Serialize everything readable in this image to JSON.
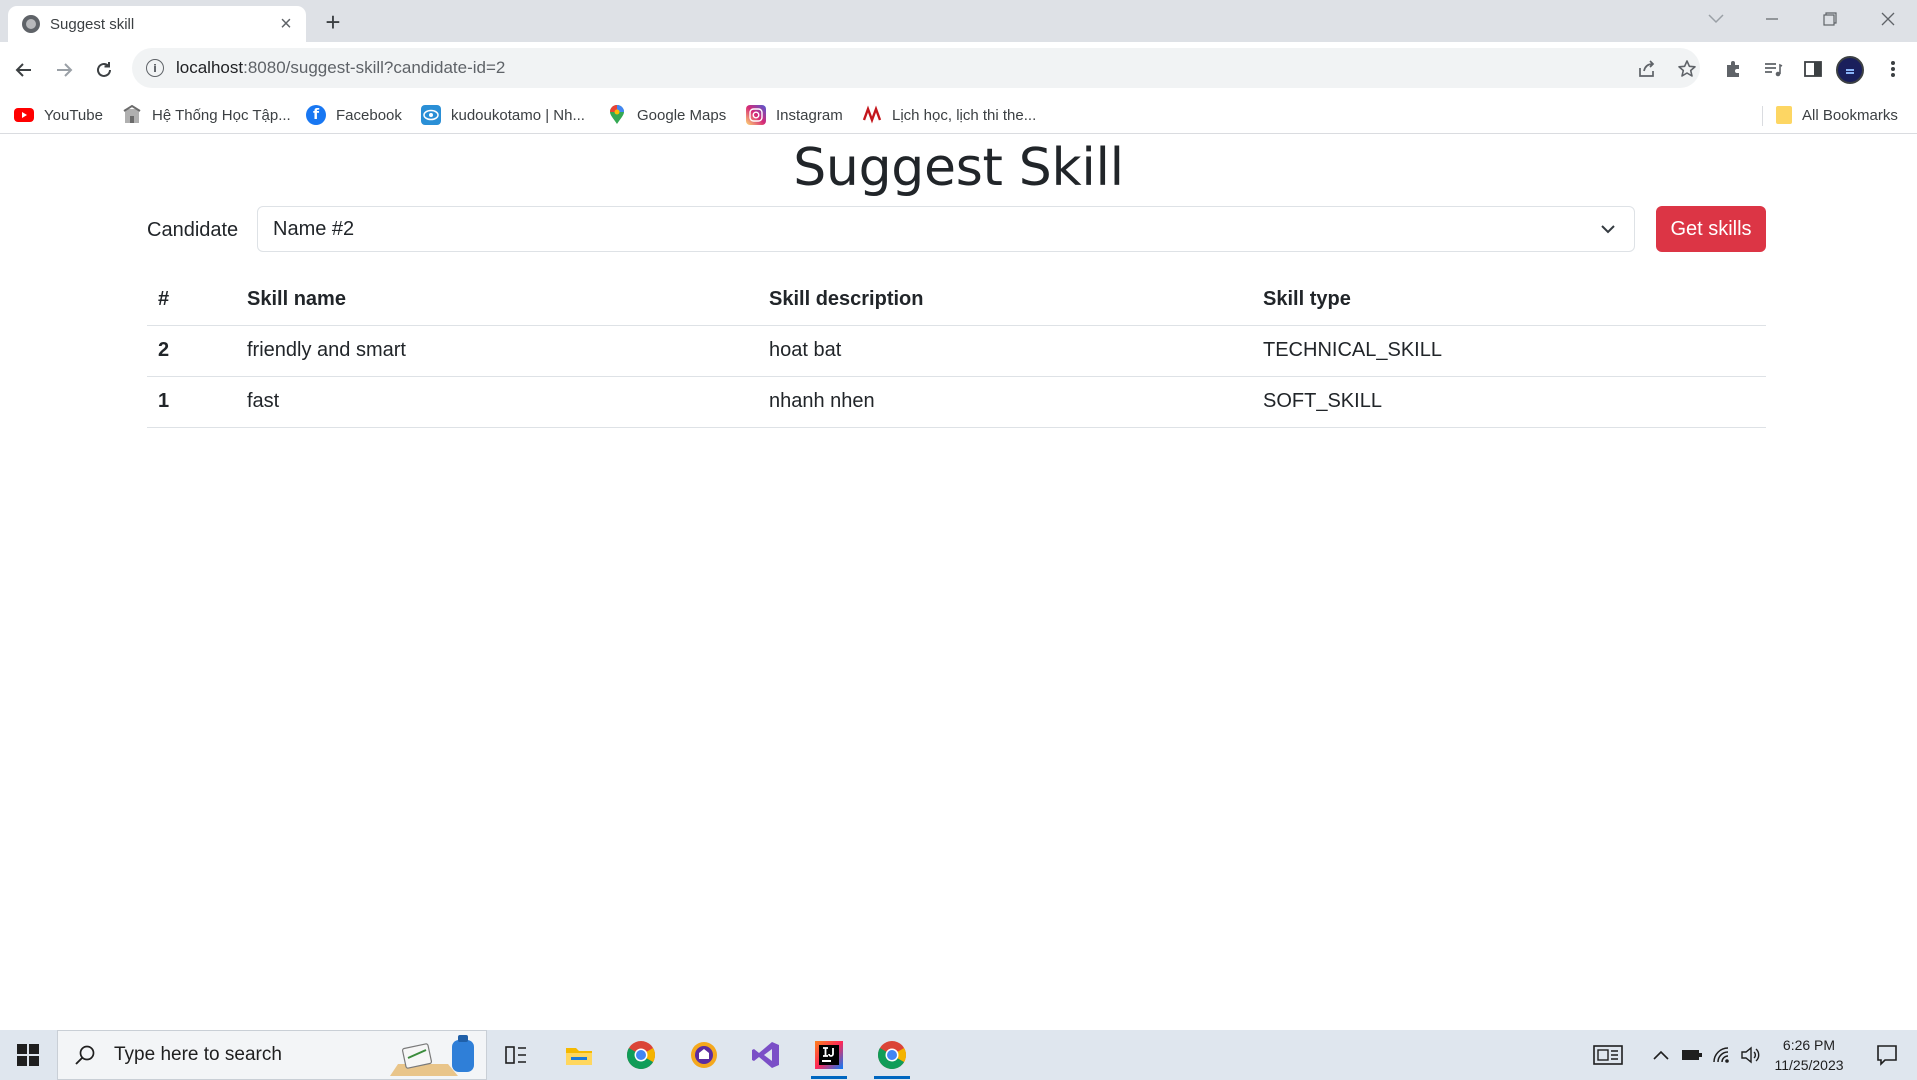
{
  "browser": {
    "tab_title": "Suggest skill",
    "new_tab_symbol": "+",
    "close_tab_symbol": "×",
    "url_host": "localhost",
    "url_rest": ":8080/suggest-skill?candidate-id=2",
    "bookmarks": [
      {
        "label": "YouTube",
        "icon": "youtube-icon",
        "color": "#ff0000"
      },
      {
        "label": "Hệ Thống Học Tập...",
        "icon": "school-icon",
        "color": "#8a8a8a"
      },
      {
        "label": "Facebook",
        "icon": "facebook-icon",
        "color": "#1877f2"
      },
      {
        "label": "kudoukotamo | Nh...",
        "icon": "eye-icon",
        "color": "#2a8fd6"
      },
      {
        "label": "Google Maps",
        "icon": "maps-pin-icon",
        "color": "#34a853"
      },
      {
        "label": "Instagram",
        "icon": "instagram-icon",
        "color": "#d62976"
      },
      {
        "label": "Lịch học, lịch thi the...",
        "icon": "university-logo-icon",
        "color": "#c4161c"
      }
    ],
    "all_bookmarks_label": "All Bookmarks"
  },
  "page": {
    "title": "Suggest Skill",
    "candidate_label": "Candidate",
    "candidate_selected": "Name #2",
    "get_skills_label": "Get skills",
    "button_color": "#dc3545"
  },
  "table": {
    "headers": [
      "#",
      "Skill name",
      "Skill description",
      "Skill type"
    ],
    "rows": [
      {
        "id": "2",
        "name": "friendly and smart",
        "description": "hoat bat",
        "type": "TECHNICAL_SKILL"
      },
      {
        "id": "1",
        "name": "fast",
        "description": "nhanh nhen",
        "type": "SOFT_SKILL"
      }
    ]
  },
  "taskbar": {
    "search_placeholder": "Type here to search",
    "time": "6:26 PM",
    "date": "11/25/2023",
    "apps": [
      "task-view-icon",
      "file-explorer-icon",
      "chrome-icon",
      "vpn-icon",
      "visual-studio-icon",
      "intellij-icon",
      "chrome-active-icon"
    ]
  }
}
